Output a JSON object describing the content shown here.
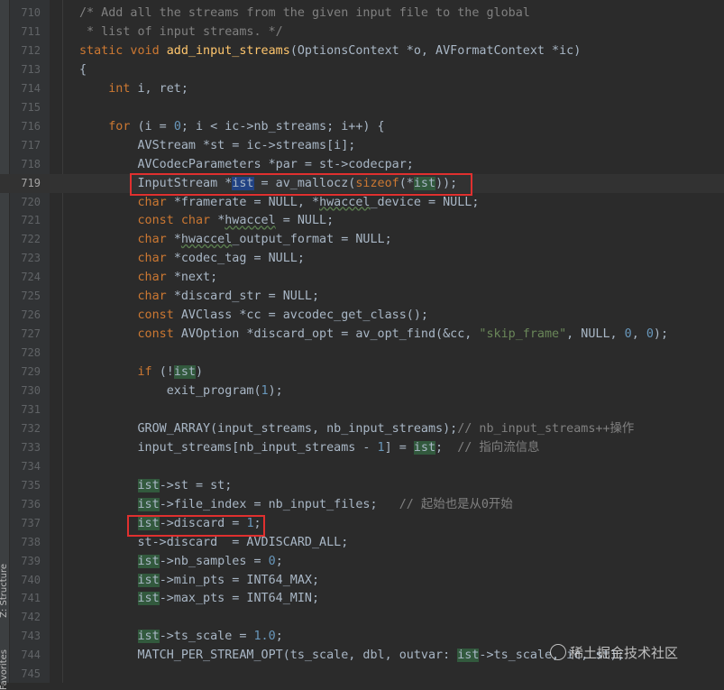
{
  "sidebar": {
    "structure_label": "Z: Structure",
    "favorites_label": "Favorites"
  },
  "lines": [
    {
      "n": "710",
      "t": [
        [
          "cm",
          "/* Add all the streams from the given input file to the global"
        ]
      ]
    },
    {
      "n": "711",
      "t": [
        [
          "cm",
          " * list of input streams. */"
        ]
      ]
    },
    {
      "n": "712",
      "t": [
        [
          "kw",
          "static void "
        ],
        [
          "fn",
          "add_input_streams"
        ],
        [
          "p",
          "(OptionsContext *o, AVFormatContext *ic)"
        ]
      ]
    },
    {
      "n": "713",
      "t": [
        [
          "p",
          "{"
        ]
      ]
    },
    {
      "n": "714",
      "t": [
        [
          "p",
          "    "
        ],
        [
          "kw",
          "int "
        ],
        [
          "p",
          "i, ret;"
        ]
      ]
    },
    {
      "n": "715",
      "t": []
    },
    {
      "n": "716",
      "t": [
        [
          "p",
          "    "
        ],
        [
          "kw",
          "for "
        ],
        [
          "p",
          "(i = "
        ],
        [
          "num",
          "0"
        ],
        [
          "p",
          "; i < ic->nb_streams; i++) {"
        ]
      ]
    },
    {
      "n": "717",
      "t": [
        [
          "p",
          "        AVStream *st = ic->streams[i];"
        ]
      ]
    },
    {
      "n": "718",
      "t": [
        [
          "p",
          "        AVCodecParameters *par = st->codecpar;"
        ]
      ]
    },
    {
      "n": "719",
      "cur": true,
      "t": [
        [
          "p",
          "        InputStream *"
        ],
        [
          "sel",
          "ist"
        ],
        [
          "p",
          " = av_mallocz("
        ],
        [
          "kw",
          "sizeof"
        ],
        [
          "p",
          "(*"
        ],
        [
          "hl",
          "ist"
        ],
        [
          "p",
          "));"
        ]
      ]
    },
    {
      "n": "720",
      "t": [
        [
          "p",
          "        "
        ],
        [
          "kw",
          "char "
        ],
        [
          "p",
          "*framerate = NULL, *"
        ],
        [
          "un",
          "hwaccel"
        ],
        [
          "p",
          "_device = NULL;"
        ]
      ]
    },
    {
      "n": "721",
      "t": [
        [
          "p",
          "        "
        ],
        [
          "kw",
          "const char "
        ],
        [
          "p",
          "*"
        ],
        [
          "un",
          "hwaccel"
        ],
        [
          "p",
          " = NULL;"
        ]
      ]
    },
    {
      "n": "722",
      "t": [
        [
          "p",
          "        "
        ],
        [
          "kw",
          "char "
        ],
        [
          "p",
          "*"
        ],
        [
          "un",
          "hwaccel"
        ],
        [
          "p",
          "_output_format = NULL;"
        ]
      ]
    },
    {
      "n": "723",
      "t": [
        [
          "p",
          "        "
        ],
        [
          "kw",
          "char "
        ],
        [
          "p",
          "*codec_tag = NULL;"
        ]
      ]
    },
    {
      "n": "724",
      "t": [
        [
          "p",
          "        "
        ],
        [
          "kw",
          "char "
        ],
        [
          "p",
          "*next;"
        ]
      ]
    },
    {
      "n": "725",
      "t": [
        [
          "p",
          "        "
        ],
        [
          "kw",
          "char "
        ],
        [
          "p",
          "*discard_str = NULL;"
        ]
      ]
    },
    {
      "n": "726",
      "t": [
        [
          "p",
          "        "
        ],
        [
          "kw",
          "const "
        ],
        [
          "p",
          "AVClass *cc = avcodec_get_class();"
        ]
      ]
    },
    {
      "n": "727",
      "t": [
        [
          "p",
          "        "
        ],
        [
          "kw",
          "const "
        ],
        [
          "p",
          "AVOption *discard_opt = av_opt_find(&cc, "
        ],
        [
          "str",
          "\"skip_frame\""
        ],
        [
          "p",
          ", NULL, "
        ],
        [
          "num",
          "0"
        ],
        [
          "p",
          ", "
        ],
        [
          "num",
          "0"
        ],
        [
          "p",
          ");"
        ]
      ]
    },
    {
      "n": "728",
      "t": []
    },
    {
      "n": "729",
      "t": [
        [
          "p",
          "        "
        ],
        [
          "kw",
          "if "
        ],
        [
          "p",
          "(!"
        ],
        [
          "hl",
          "ist"
        ],
        [
          "p",
          ")"
        ]
      ]
    },
    {
      "n": "730",
      "t": [
        [
          "p",
          "            exit_program("
        ],
        [
          "num",
          "1"
        ],
        [
          "p",
          ");"
        ]
      ]
    },
    {
      "n": "731",
      "t": []
    },
    {
      "n": "732",
      "t": [
        [
          "p",
          "        GROW_ARRAY(input_streams, nb_input_streams);"
        ],
        [
          "cm",
          "// nb_input_streams++操作"
        ]
      ]
    },
    {
      "n": "733",
      "t": [
        [
          "p",
          "        input_streams[nb_input_streams - "
        ],
        [
          "num",
          "1"
        ],
        [
          "p",
          "] = "
        ],
        [
          "hl",
          "ist"
        ],
        [
          "p",
          ";  "
        ],
        [
          "cm",
          "// 指向流信息"
        ]
      ]
    },
    {
      "n": "734",
      "t": []
    },
    {
      "n": "735",
      "t": [
        [
          "p",
          "        "
        ],
        [
          "hl",
          "ist"
        ],
        [
          "p",
          "->st = st;"
        ]
      ]
    },
    {
      "n": "736",
      "t": [
        [
          "p",
          "        "
        ],
        [
          "hl",
          "ist"
        ],
        [
          "p",
          "->file_index = nb_input_files;   "
        ],
        [
          "cm",
          "// 起始也是从0开始"
        ]
      ]
    },
    {
      "n": "737",
      "t": [
        [
          "p",
          "        "
        ],
        [
          "hl",
          "ist"
        ],
        [
          "p",
          "->discard = "
        ],
        [
          "num",
          "1"
        ],
        [
          "p",
          ";"
        ]
      ]
    },
    {
      "n": "738",
      "t": [
        [
          "p",
          "        st->discard  = AVDISCARD_ALL;"
        ]
      ]
    },
    {
      "n": "739",
      "t": [
        [
          "p",
          "        "
        ],
        [
          "hl",
          "ist"
        ],
        [
          "p",
          "->nb_samples = "
        ],
        [
          "num",
          "0"
        ],
        [
          "p",
          ";"
        ]
      ]
    },
    {
      "n": "740",
      "t": [
        [
          "p",
          "        "
        ],
        [
          "hl",
          "ist"
        ],
        [
          "p",
          "->min_pts = INT64_MAX;"
        ]
      ]
    },
    {
      "n": "741",
      "t": [
        [
          "p",
          "        "
        ],
        [
          "hl",
          "ist"
        ],
        [
          "p",
          "->max_pts = INT64_MIN;"
        ]
      ]
    },
    {
      "n": "742",
      "t": []
    },
    {
      "n": "743",
      "t": [
        [
          "p",
          "        "
        ],
        [
          "hl",
          "ist"
        ],
        [
          "p",
          "->ts_scale = "
        ],
        [
          "num",
          "1.0"
        ],
        [
          "p",
          ";"
        ]
      ]
    },
    {
      "n": "744",
      "t": [
        [
          "p",
          "        MATCH_PER_STREAM_OPT(ts_scale, dbl, "
        ],
        [
          "hint",
          "outvar:"
        ],
        [
          "p",
          " "
        ],
        [
          "hl",
          "ist"
        ],
        [
          "p",
          "->ts_scale, ic, st);"
        ]
      ]
    },
    {
      "n": "745",
      "t": []
    }
  ],
  "watermark": "稀土掘金技术社区",
  "colors": {
    "background": "#2b2b2b",
    "gutter": "#313335",
    "keyword": "#cc7832",
    "comment": "#808080",
    "function": "#ffc66d",
    "number": "#6897bb",
    "string": "#6a8759",
    "highlight_box": "#e0302f"
  }
}
